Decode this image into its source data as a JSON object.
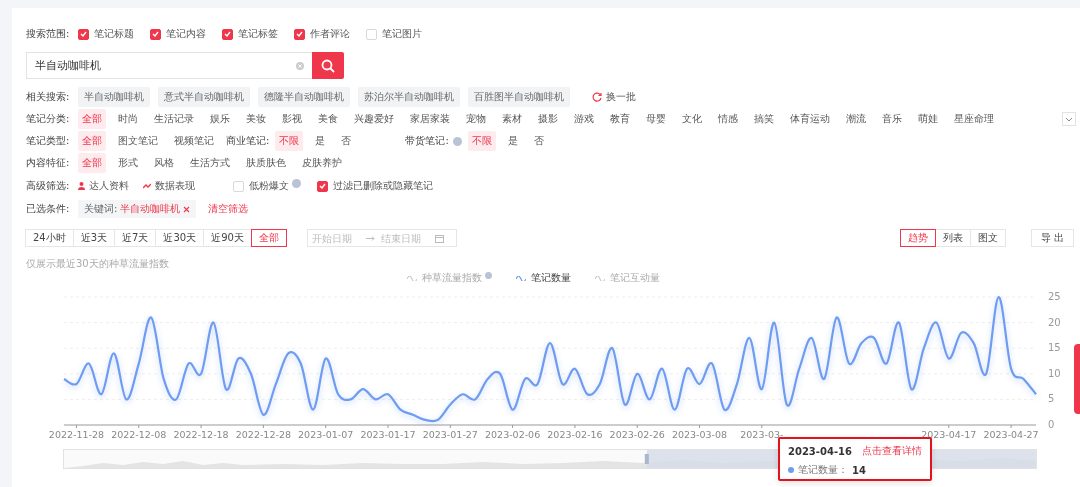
{
  "search_scope": {
    "label": "搜索范围:",
    "options": [
      {
        "label": "笔记标题",
        "checked": true
      },
      {
        "label": "笔记内容",
        "checked": true
      },
      {
        "label": "笔记标签",
        "checked": true
      },
      {
        "label": "作者评论",
        "checked": true
      },
      {
        "label": "笔记图片",
        "checked": false
      }
    ]
  },
  "search": {
    "value": "半自动咖啡机"
  },
  "related": {
    "label": "相关搜索:",
    "items": [
      "半自动咖啡机",
      "意式半自动咖啡机",
      "德隆半自动咖啡机",
      "苏泊尔半自动咖啡机",
      "百胜图半自动咖啡机"
    ],
    "refresh": "换一批"
  },
  "filter_rows": [
    {
      "expandable": true,
      "groups": [
        {
          "label": "笔记分类:",
          "options": [
            {
              "label": "全部",
              "selected": true
            },
            {
              "label": "时尚",
              "selected": false
            },
            {
              "label": "生活记录",
              "selected": false
            },
            {
              "label": "娱乐",
              "selected": false
            },
            {
              "label": "美妆",
              "selected": false
            },
            {
              "label": "影视",
              "selected": false
            },
            {
              "label": "美食",
              "selected": false
            },
            {
              "label": "兴趣爱好",
              "selected": false
            },
            {
              "label": "家居家装",
              "selected": false
            },
            {
              "label": "宠物",
              "selected": false
            },
            {
              "label": "素材",
              "selected": false
            },
            {
              "label": "摄影",
              "selected": false
            },
            {
              "label": "游戏",
              "selected": false
            },
            {
              "label": "教育",
              "selected": false
            },
            {
              "label": "母婴",
              "selected": false
            },
            {
              "label": "文化",
              "selected": false
            },
            {
              "label": "情感",
              "selected": false
            },
            {
              "label": "搞笑",
              "selected": false
            },
            {
              "label": "体育运动",
              "selected": false
            },
            {
              "label": "潮流",
              "selected": false
            },
            {
              "label": "音乐",
              "selected": false
            },
            {
              "label": "萌娃",
              "selected": false
            },
            {
              "label": "星座命理",
              "selected": false
            }
          ]
        }
      ]
    },
    {
      "groups": [
        {
          "label": "笔记类型:",
          "options": [
            {
              "label": "全部",
              "selected": true
            },
            {
              "label": "图文笔记",
              "selected": false
            },
            {
              "label": "视频笔记",
              "selected": false
            }
          ]
        },
        {
          "label": "商业笔记:",
          "options": [
            {
              "label": "不限",
              "selected": true
            },
            {
              "label": "是",
              "selected": false
            },
            {
              "label": "否",
              "selected": false
            }
          ]
        },
        {
          "label": "带货笔记:",
          "help": true,
          "options": [
            {
              "label": "不限",
              "selected": true
            },
            {
              "label": "是",
              "selected": false
            },
            {
              "label": "否",
              "selected": false
            }
          ]
        }
      ]
    },
    {
      "groups": [
        {
          "label": "内容特征:",
          "options": [
            {
              "label": "全部",
              "selected": true
            },
            {
              "label": "形式",
              "selected": false
            },
            {
              "label": "风格",
              "selected": false
            },
            {
              "label": "生活方式",
              "selected": false
            },
            {
              "label": "肤质肤色",
              "selected": false
            },
            {
              "label": "皮肤养护",
              "selected": false
            }
          ]
        }
      ]
    }
  ],
  "advanced": {
    "label": "高级筛选:",
    "links": [
      {
        "label": "达人资料",
        "kind": "person"
      },
      {
        "label": "数据表现",
        "kind": "data"
      }
    ],
    "checks": [
      {
        "label": "低粉爆文",
        "checked": false,
        "help": true
      },
      {
        "label": "过滤已删除或隐藏笔记",
        "checked": true
      }
    ]
  },
  "selected_conditions": {
    "label": "已选条件:",
    "tags": [
      {
        "key": "关键词:",
        "value": "半自动咖啡机"
      }
    ],
    "clear": "清空筛选"
  },
  "toolbar": {
    "ranges": [
      {
        "label": "24小时",
        "selected": false
      },
      {
        "label": "近3天",
        "selected": false
      },
      {
        "label": "近7天",
        "selected": false
      },
      {
        "label": "近30天",
        "selected": false
      },
      {
        "label": "近90天",
        "selected": false
      },
      {
        "label": "全部",
        "selected": true
      }
    ],
    "start_placeholder": "开始日期",
    "end_placeholder": "结束日期",
    "views": [
      {
        "label": "趋势",
        "selected": true
      },
      {
        "label": "列表",
        "selected": false
      },
      {
        "label": "图文",
        "selected": false
      }
    ],
    "export": "导 出"
  },
  "trend": {
    "note": "仅展示最近30天的种草流量指数",
    "legend": [
      {
        "label": "种草流量指数",
        "selected": false,
        "help": true
      },
      {
        "label": "笔记数量",
        "selected": true
      },
      {
        "label": "笔记互动量",
        "selected": false
      }
    ],
    "chart_data": {
      "type": "line",
      "grid": true,
      "categories": [
        null,
        "2022-11-28",
        null,
        null,
        null,
        null,
        "2022-12-08",
        null,
        null,
        null,
        null,
        "2022-12-18",
        null,
        null,
        null,
        null,
        "2022-12-28",
        null,
        null,
        null,
        null,
        "2023-01-07",
        null,
        null,
        null,
        null,
        "2023-01-17",
        null,
        null,
        null,
        null,
        "2023-01-27",
        null,
        null,
        null,
        null,
        "2023-02-06",
        null,
        null,
        null,
        null,
        "2023-02-16",
        null,
        null,
        null,
        null,
        "2023-02-26",
        null,
        null,
        null,
        null,
        "2023-03-08",
        null,
        null,
        null,
        null,
        "2023-03-",
        null,
        null,
        null,
        null,
        null,
        null,
        null,
        null,
        null,
        null,
        null,
        null,
        null,
        null,
        "2023-04-17",
        null,
        null,
        null,
        null,
        "2023-04-27",
        null,
        null
      ],
      "series": [
        {
          "color": "#6f9cf0",
          "values": [
            9,
            8,
            12,
            6,
            14,
            5,
            12,
            21,
            9,
            5,
            12,
            10,
            20,
            7,
            13,
            10,
            2,
            8,
            14,
            12,
            3,
            13,
            6,
            5,
            7,
            5,
            6,
            3,
            2,
            1,
            1,
            4,
            6,
            5,
            9,
            10,
            3,
            9,
            8,
            16,
            8,
            11,
            6,
            8,
            15,
            4,
            10,
            5,
            11,
            3,
            11,
            8,
            12,
            3,
            8,
            17,
            7,
            20,
            4,
            11,
            17,
            9,
            21,
            12,
            16,
            17,
            12,
            20,
            7,
            15,
            20,
            13,
            18,
            16,
            10,
            25,
            11,
            9,
            6
          ]
        }
      ],
      "ylim": [
        0,
        25
      ],
      "yticks": [
        0,
        5,
        10,
        15,
        20,
        25
      ]
    },
    "zoom_slider": {
      "level": 0.4
    },
    "tooltip": {
      "date": "2023-04-16",
      "link": "点击查看详情",
      "series": "笔记数量：",
      "value": "14"
    }
  }
}
